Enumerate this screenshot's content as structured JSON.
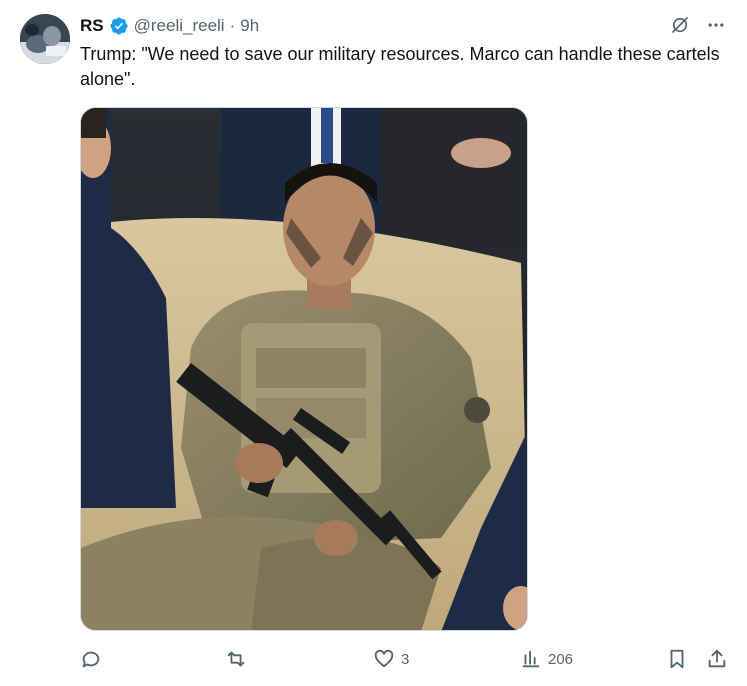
{
  "author": {
    "name": "RS",
    "handle": "@reeli_reeli",
    "separator": "·",
    "time": "9h"
  },
  "post": {
    "text": "Trump: \"We need to save our military resources. Marco can handle these cartels alone\"."
  },
  "icons": {
    "verified": "verified-badge-icon",
    "grok": "grok-icon",
    "more": "more-icon",
    "reply": "reply-icon",
    "repost": "repost-icon",
    "like": "heart-icon",
    "views": "views-icon",
    "bookmark": "bookmark-icon",
    "share": "share-icon"
  },
  "metrics": {
    "reply_count": "",
    "repost_count": "",
    "like_count": "3",
    "view_count": "206"
  },
  "colors": {
    "text": "#0f1419",
    "secondary": "#536471",
    "verified": "#1d9bf0"
  }
}
